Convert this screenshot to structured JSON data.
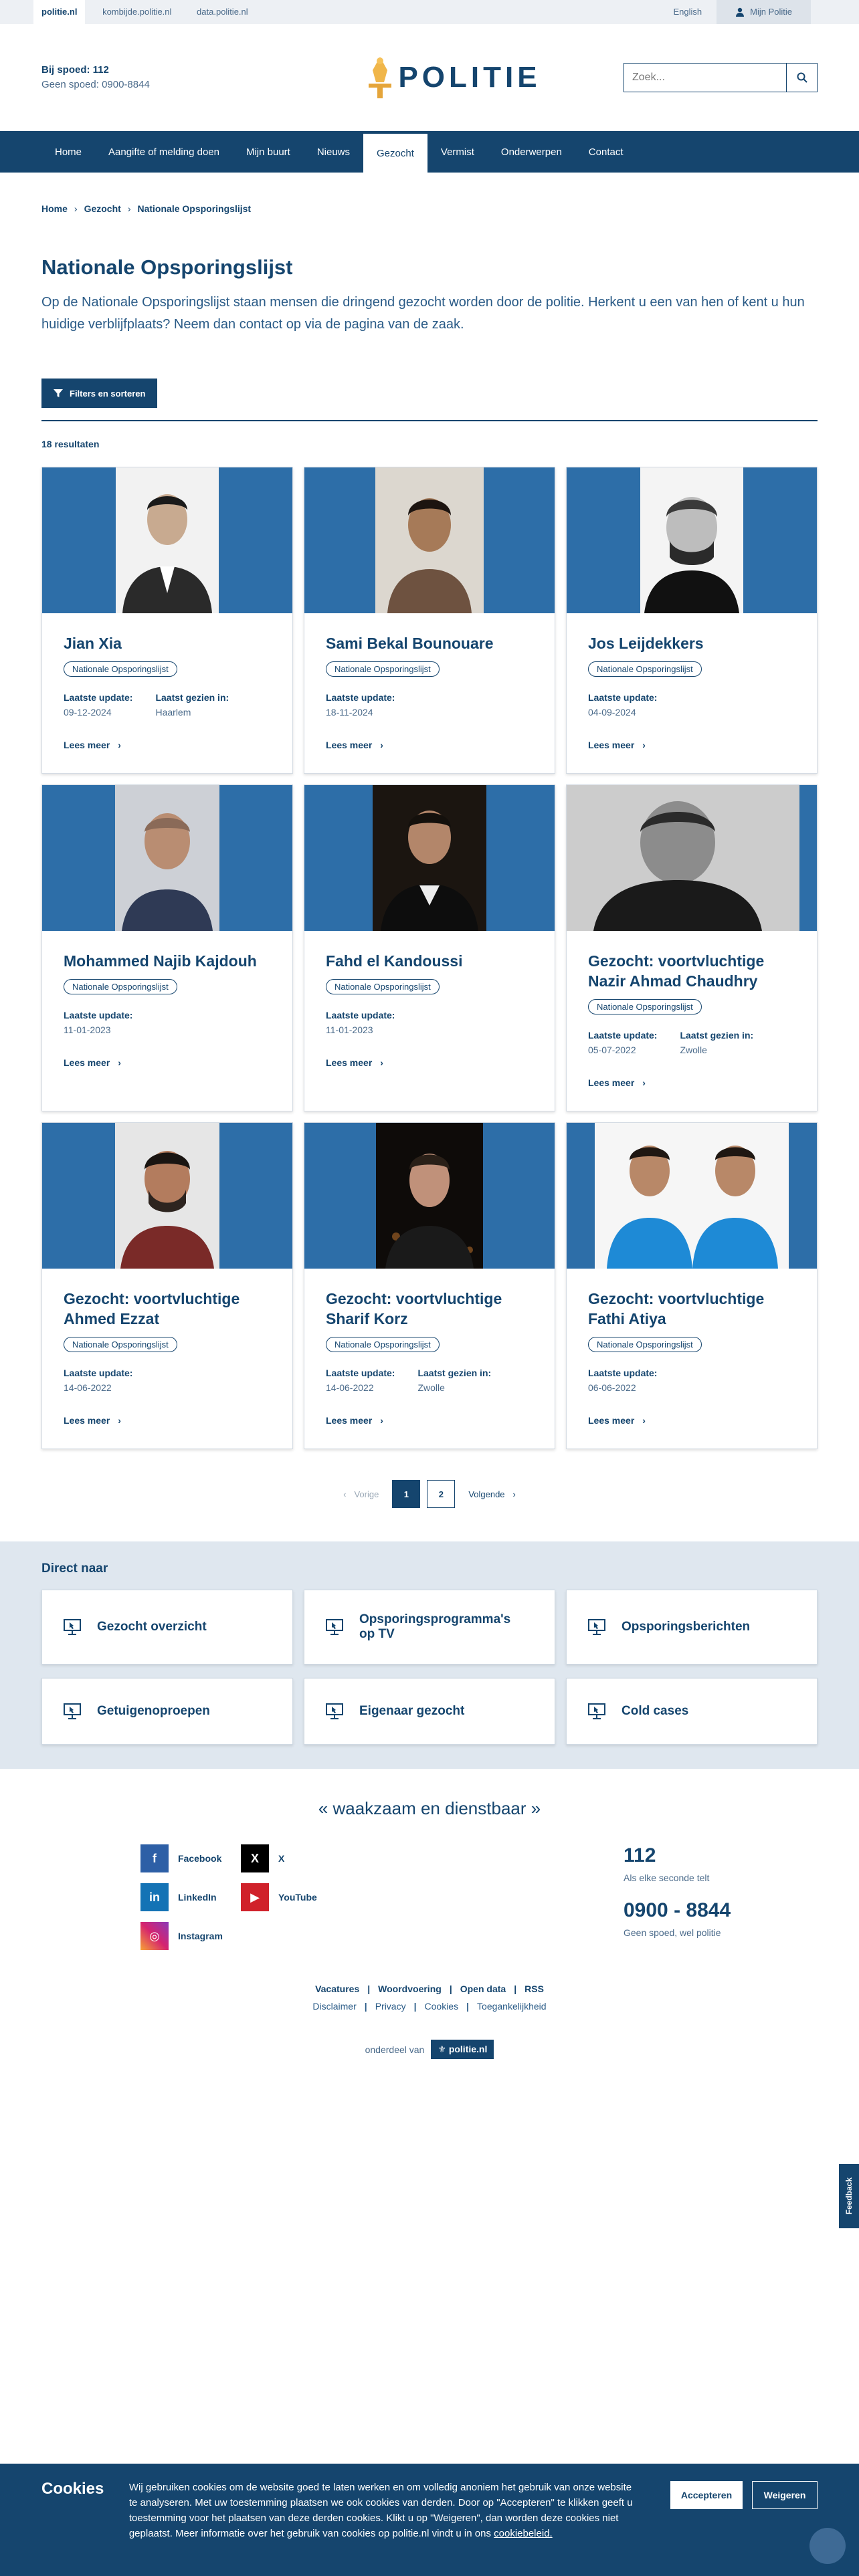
{
  "topbar": {
    "links": [
      "politie.nl",
      "kombijde.politie.nl",
      "data.politie.nl"
    ],
    "language": "English",
    "account": "Mijn Politie"
  },
  "header": {
    "emergency_label": "Bij spoed: 112",
    "non_emergency_label": "Geen spoed: 0900-8844",
    "logo_text": "POLITIE",
    "search_placeholder": "Zoek..."
  },
  "nav": [
    "Home",
    "Aangifte of melding doen",
    "Mijn buurt",
    "Nieuws",
    "Gezocht",
    "Vermist",
    "Onderwerpen",
    "Contact"
  ],
  "nav_active": "Gezocht",
  "breadcrumb": [
    "Home",
    "Gezocht",
    "Nationale Opsporingslijst"
  ],
  "page": {
    "title": "Nationale Opsporingslijst",
    "intro": "Op de Nationale Opsporingslijst staan mensen die dringend gezocht worden door de politie. Herkent u een van hen of kent u hun huidige verblijfplaats? Neem dan contact op via de pagina van de zaak.",
    "filter_button": "Filters en sorteren",
    "result_count": "18 resultaten"
  },
  "card_labels": {
    "tag": "Nationale Opsporingslijst",
    "updated": "Laatste update:",
    "seen": "Laatst gezien in:",
    "more": "Lees meer"
  },
  "cards": [
    {
      "name": "Jian Xia",
      "updated": "09-12-2024",
      "seen": "Haarlem"
    },
    {
      "name": "Sami Bekal Bounouare",
      "updated": "18-11-2024",
      "seen": ""
    },
    {
      "name": "Jos Leijdekkers",
      "updated": "04-09-2024",
      "seen": ""
    },
    {
      "name": "Mohammed Najib Kajdouh",
      "updated": "11-01-2023",
      "seen": ""
    },
    {
      "name": "Fahd el Kandoussi",
      "updated": "11-01-2023",
      "seen": ""
    },
    {
      "name": "Gezocht: voortvluchtige Nazir Ahmad Chaudhry",
      "updated": "05-07-2022",
      "seen": "Zwolle"
    },
    {
      "name": "Gezocht: voortvluchtige Ahmed Ezzat",
      "updated": "14-06-2022",
      "seen": ""
    },
    {
      "name": "Gezocht: voortvluchtige Sharif Korz",
      "updated": "14-06-2022",
      "seen": "Zwolle"
    },
    {
      "name": "Gezocht: voortvluchtige Fathi Atiya",
      "updated": "06-06-2022",
      "seen": ""
    }
  ],
  "pagination": {
    "prev": "Vorige",
    "pages": [
      "1",
      "2"
    ],
    "current": "1",
    "next": "Volgende"
  },
  "direct": {
    "title": "Direct naar",
    "items": [
      "Gezocht overzicht",
      "Opsporingsprogramma's op TV",
      "Opsporingsberichten",
      "Getuigenoproepen",
      "Eigenaar gezocht",
      "Cold cases"
    ]
  },
  "footer": {
    "motto": "« waakzaam en dienstbaar »",
    "socials": [
      "Facebook",
      "X",
      "LinkedIn",
      "YouTube",
      "Instagram"
    ],
    "emergency_number": "112",
    "emergency_sub": "Als elke seconde telt",
    "non_emergency_number": "0900 - 8844",
    "non_emergency_sub": "Geen spoed, wel politie",
    "links_row1": [
      "Vacatures",
      "Woordvoering",
      "Open data",
      "RSS"
    ],
    "links_row2": [
      "Disclaimer",
      "Privacy",
      "Cookies",
      "Toegankelijkheid"
    ],
    "part_of": "onderdeel van",
    "part_badge": "politie.nl"
  },
  "feedback": "Feedback",
  "cookie": {
    "title": "Cookies",
    "text": "Wij gebruiken cookies om de website goed te laten werken en om volledig anoniem het gebruik van onze website te analyseren. Met uw toestemming plaatsen we ook cookies van derden. Door op \"Accepteren\" te klikken geeft u toestemming voor het plaatsen van deze derden cookies. Klikt u op \"Weigeren\", dan worden deze cookies niet geplaatst. Meer informatie over het gebruik van cookies op politie.nl vindt u in ons",
    "link": "cookiebeleid.",
    "accept": "Accepteren",
    "decline": "Weigeren"
  },
  "colors": {
    "brand": "#15456e",
    "photo_bg": "#2d6ea8",
    "tile_bg": "#dfe7ef"
  }
}
